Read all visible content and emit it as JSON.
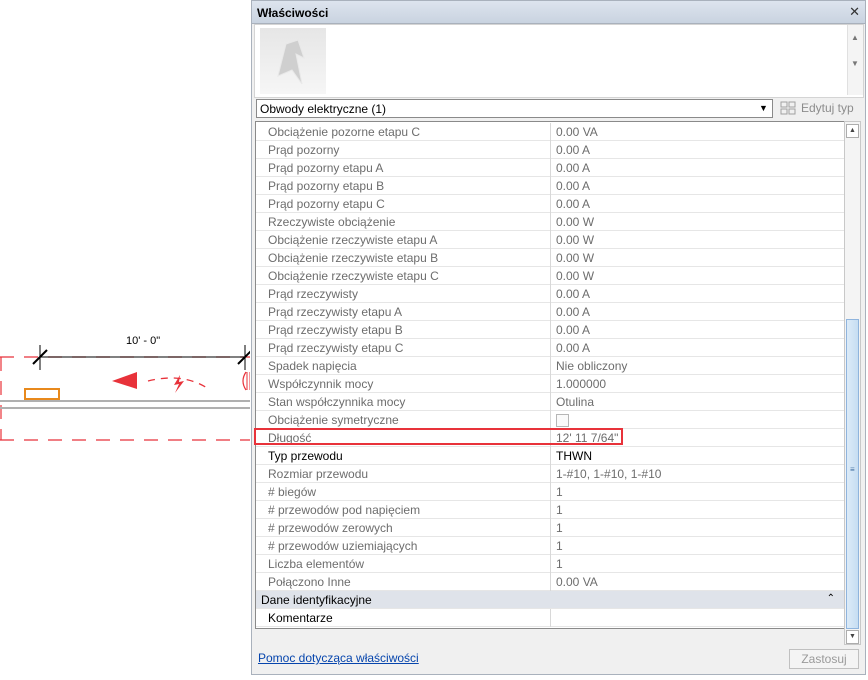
{
  "canvas": {
    "dimension_text": "10' - 0\"",
    "colors": {
      "red": "#e8323a",
      "orange": "#e8891c",
      "wire": "#b0b0b0"
    }
  },
  "properties": {
    "title": "Właściwości",
    "close_icon": "close-icon",
    "selector_value": "Obwody elektryczne (1)",
    "edit_type_label": "Edytuj typ",
    "rows": [
      {
        "name": "Obciążenie pozorne etapu C",
        "value": "0.00 VA",
        "style": "grey"
      },
      {
        "name": "Prąd pozorny",
        "value": "0.00 A",
        "style": "grey"
      },
      {
        "name": "Prąd pozorny etapu A",
        "value": "0.00 A",
        "style": "grey"
      },
      {
        "name": "Prąd pozorny etapu B",
        "value": "0.00 A",
        "style": "grey"
      },
      {
        "name": "Prąd pozorny etapu C",
        "value": "0.00 A",
        "style": "grey"
      },
      {
        "name": "Rzeczywiste obciążenie",
        "value": "0.00 W",
        "style": "grey"
      },
      {
        "name": "Obciążenie rzeczywiste etapu A",
        "value": "0.00 W",
        "style": "grey"
      },
      {
        "name": "Obciążenie rzeczywiste etapu B",
        "value": "0.00 W",
        "style": "grey"
      },
      {
        "name": "Obciążenie rzeczywiste etapu C",
        "value": "0.00 W",
        "style": "grey"
      },
      {
        "name": "Prąd rzeczywisty",
        "value": "0.00 A",
        "style": "grey"
      },
      {
        "name": "Prąd rzeczywisty etapu A",
        "value": "0.00 A",
        "style": "grey"
      },
      {
        "name": "Prąd rzeczywisty etapu B",
        "value": "0.00 A",
        "style": "grey"
      },
      {
        "name": "Prąd rzeczywisty etapu C",
        "value": "0.00 A",
        "style": "grey"
      },
      {
        "name": "Spadek napięcia",
        "value": "Nie obliczony",
        "style": "grey"
      },
      {
        "name": "Współczynnik mocy",
        "value": "1.000000",
        "style": "grey"
      },
      {
        "name": "Stan współczynnika mocy",
        "value": "Otulina",
        "style": "grey"
      },
      {
        "name": "Obciążenie symetryczne",
        "value": "",
        "style": "grey",
        "checkbox": true
      },
      {
        "name": "Długość",
        "value": "12'  11 7/64\"",
        "style": "grey"
      },
      {
        "name": "Typ przewodu",
        "value": "THWN",
        "style": "dark"
      },
      {
        "name": "Rozmiar przewodu",
        "value": "1-#10, 1-#10, 1-#10",
        "style": "grey"
      },
      {
        "name": "# biegów",
        "value": "1",
        "style": "grey"
      },
      {
        "name": "# przewodów pod napięciem",
        "value": "1",
        "style": "grey"
      },
      {
        "name": "# przewodów zerowych",
        "value": "1",
        "style": "grey"
      },
      {
        "name": "# przewodów uziemiających",
        "value": "1",
        "style": "grey"
      },
      {
        "name": "Liczba elementów",
        "value": "1",
        "style": "grey"
      },
      {
        "name": "Połączono Inne",
        "value": "0.00 VA",
        "style": "grey"
      },
      {
        "name": "Dane identyfikacyjne",
        "value": "",
        "style": "cat"
      },
      {
        "name": "Komentarze",
        "value": "",
        "style": "dark"
      }
    ],
    "help_link": "Pomoc dotycząca właściwości",
    "apply_label": "Zastosuj"
  }
}
